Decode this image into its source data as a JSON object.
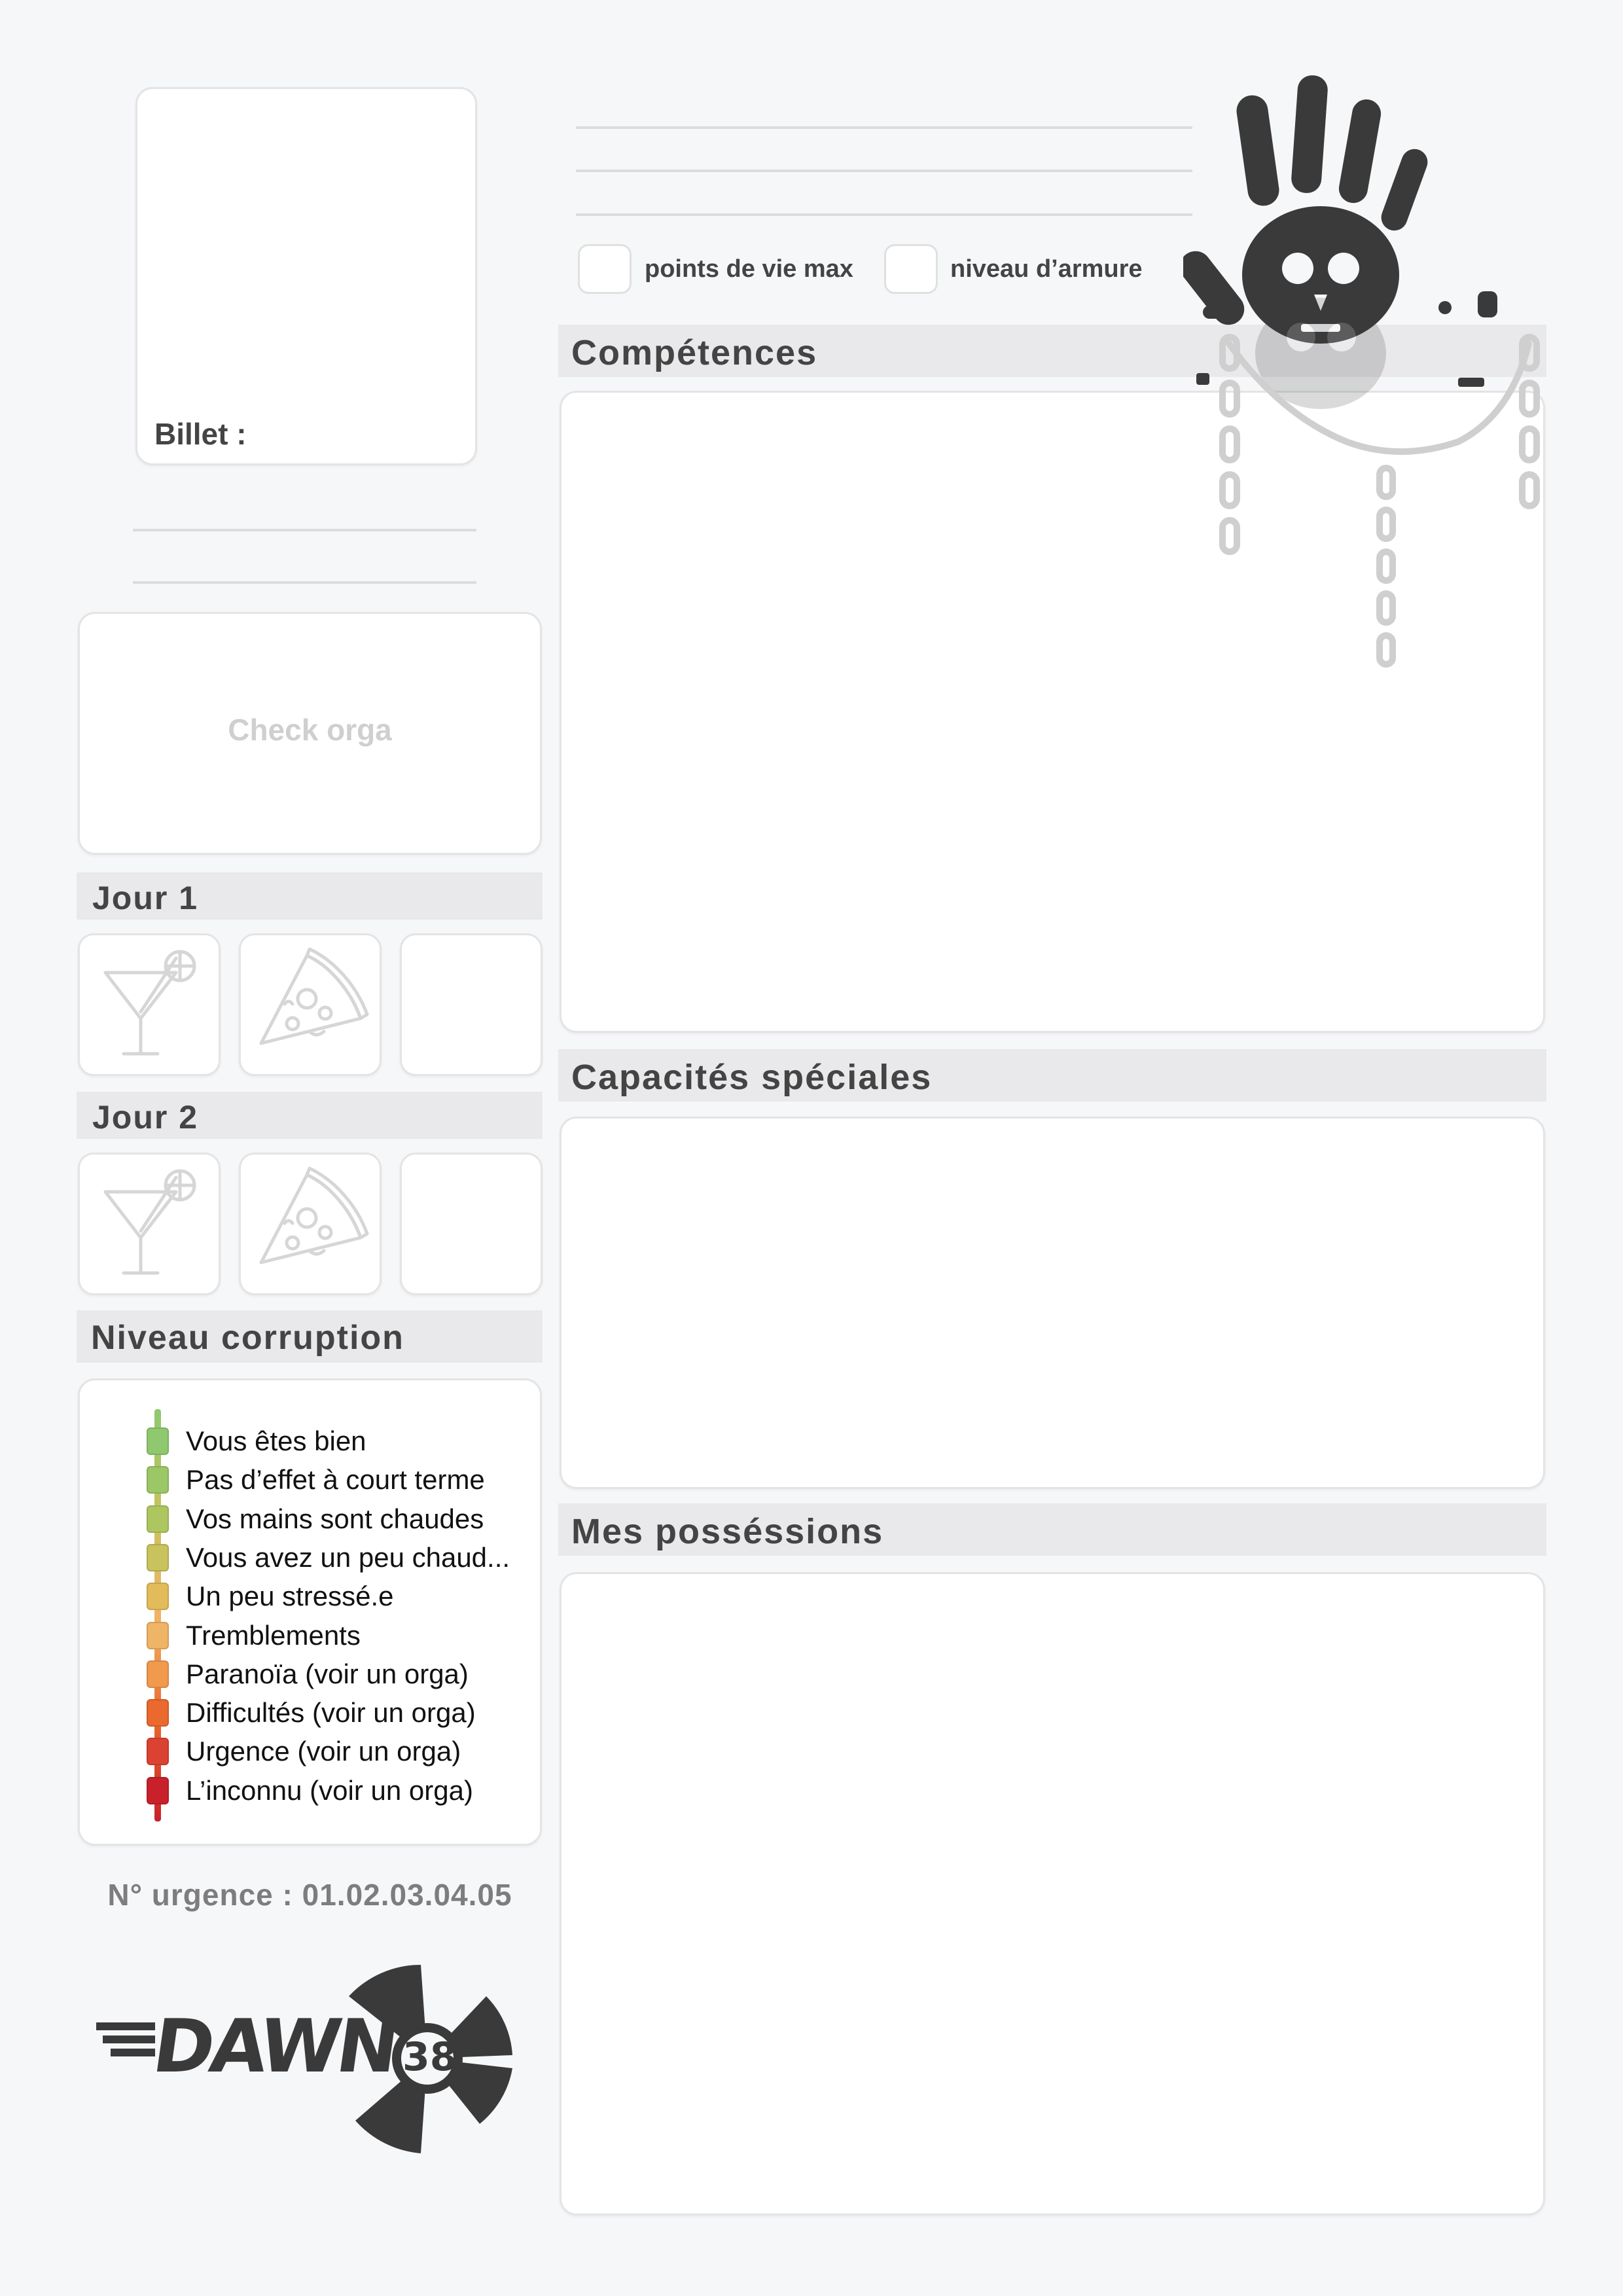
{
  "photo": {
    "label": "Billet :"
  },
  "stats": {
    "hp_label": "points de vie max",
    "armor_label": "niveau d’armure"
  },
  "check": {
    "label": "Check orga"
  },
  "days": [
    {
      "title": "Jour 1",
      "slots": [
        "cocktail-icon",
        "pizza-icon",
        "empty"
      ]
    },
    {
      "title": "Jour 2",
      "slots": [
        "cocktail-icon",
        "pizza-icon",
        "empty"
      ]
    }
  ],
  "corruption": {
    "title": "Niveau corruption",
    "levels": [
      {
        "label": "Vous êtes bien",
        "color": "#8fc86e"
      },
      {
        "label": "Pas d’effet à court terme",
        "color": "#9cc766"
      },
      {
        "label": "Vos mains sont chaudes",
        "color": "#aec660"
      },
      {
        "label": "Vous avez un peu chaud...",
        "color": "#c8c35c"
      },
      {
        "label": "Un peu stressé.e",
        "color": "#e2bb5a"
      },
      {
        "label": "Tremblements",
        "color": "#f0b466"
      },
      {
        "label": "Paranoïa (voir un orga)",
        "color": "#f19a4e"
      },
      {
        "label": "Difficultés (voir un orga)",
        "color": "#e9692f"
      },
      {
        "label": "Urgence (voir un orga)",
        "color": "#dc4232"
      },
      {
        "label": "L’inconnu (voir un orga)",
        "color": "#c9212b"
      }
    ]
  },
  "emergency": {
    "text": "N° urgence : 01.02.03.04.05"
  },
  "logo": {
    "text": "DAWN",
    "number": "38"
  },
  "sections": {
    "skills": "Compétences",
    "abilities": "Capacités spéciales",
    "possessions": "Mes posséssions"
  },
  "icons": {
    "hand": "handprint-skull-icon"
  }
}
